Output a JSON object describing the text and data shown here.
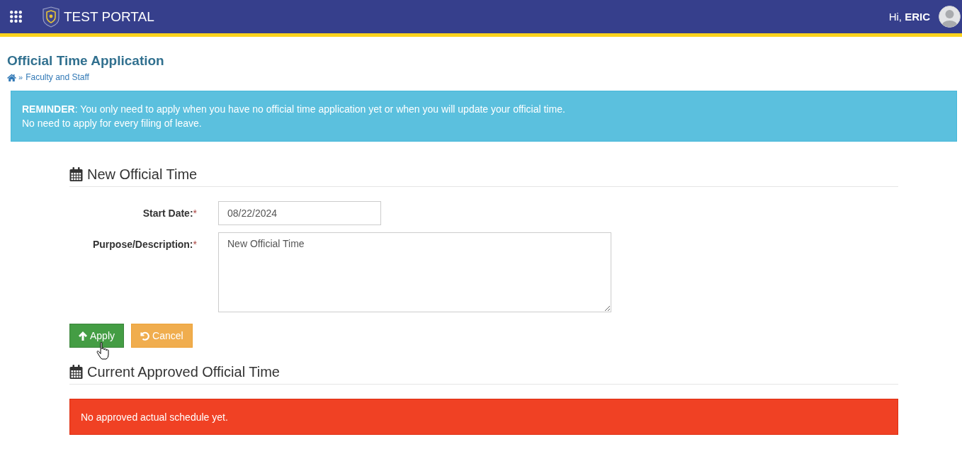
{
  "header": {
    "app_title": "TEST PORTAL",
    "greeting": "Hi, **ERIC**"
  },
  "page": {
    "title": "Official Time Application",
    "breadcrumb": {
      "separator": "»",
      "items": [
        "Faculty and Staff"
      ]
    }
  },
  "reminder": {
    "lines": [
      "**REMINDER**: You only need to apply when you have no official time application yet or when you will update your official time.",
      "No need to apply for every filing of leave."
    ]
  },
  "form": {
    "heading": "New Official Time",
    "fields": [
      {
        "kind": "date",
        "label": "Start Date:",
        "required_mark": "*",
        "value": "08/22/2024"
      },
      {
        "kind": "textarea",
        "label": "Purpose/Description:",
        "required_mark": "*",
        "value": "New Official Time"
      }
    ],
    "buttons": [
      {
        "kind": "apply",
        "label": "Apply"
      },
      {
        "kind": "cancel",
        "label": "Cancel"
      }
    ]
  },
  "approved": {
    "heading": "Current Approved Official Time",
    "message": "No approved actual schedule yet."
  }
}
